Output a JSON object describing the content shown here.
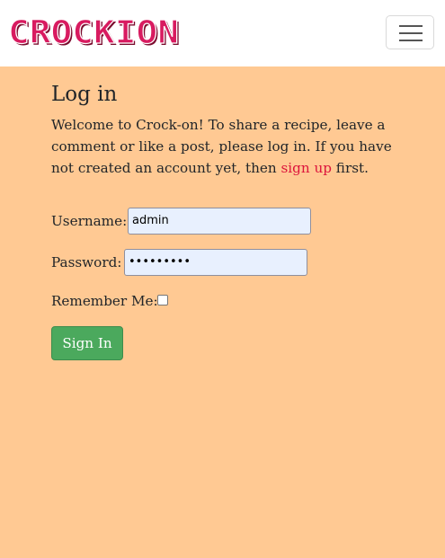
{
  "navbar": {
    "brand": "CROCKION",
    "toggler_icon": "hamburger-menu-icon"
  },
  "page": {
    "title": "Log in",
    "intro_before": "Welcome to Crock-on! To share a recipe, leave a comment or like a post, please log in. If you have not created an account yet, then ",
    "signup_link": "sign up",
    "intro_after": " first."
  },
  "form": {
    "username_label": "Username:",
    "username_value": "admin",
    "password_label": "Password:",
    "password_value": "•••••••••",
    "remember_label": "Remember Me:",
    "remember_checked": false,
    "submit_label": "Sign In"
  },
  "colors": {
    "background": "#ffc993",
    "brand": "#d81b60",
    "link": "#dc143c",
    "button": "#4ba95d",
    "input_fill": "#e8f0fe"
  }
}
